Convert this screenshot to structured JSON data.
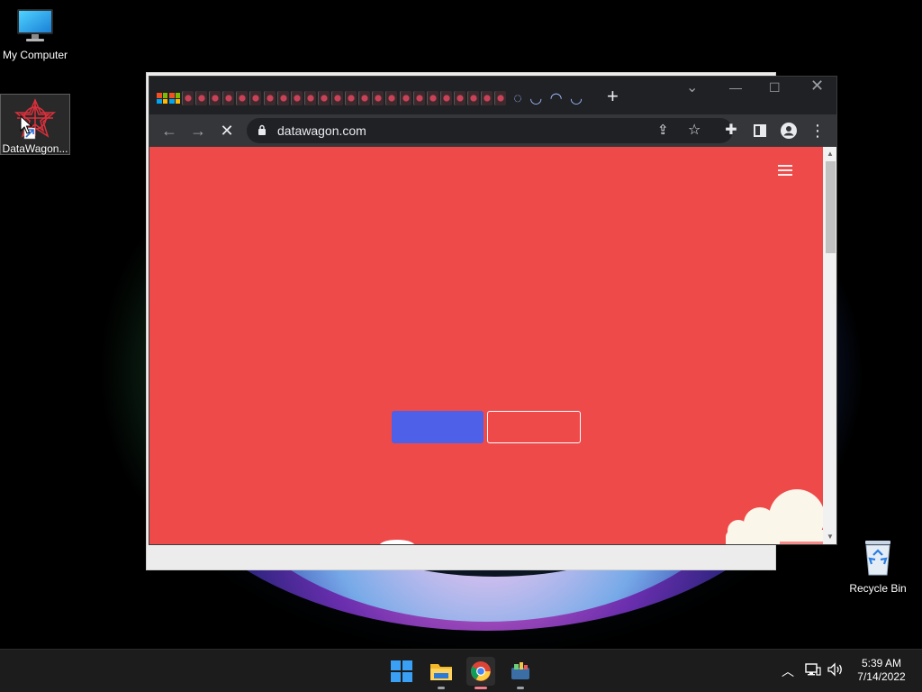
{
  "desktop": {
    "icons": [
      {
        "label": "My Computer",
        "icon": "monitor-icon"
      },
      {
        "label": "DataWagon...",
        "icon": "datawagon-app-icon"
      },
      {
        "label": "Recycle Bin",
        "icon": "recycle-bin-icon"
      }
    ]
  },
  "browser": {
    "url": "datawagon.com",
    "colors": {
      "page_background": "#ef4a4a",
      "primary_button": "#4e5fe8",
      "chrome_dark": "#202124",
      "toolbar": "#35363a"
    }
  },
  "taskbar": {
    "apps": [
      "windows-start-icon",
      "file-explorer-icon",
      "chrome-icon",
      "datawagon-icon"
    ],
    "tray_icons": [
      "chevron-up-icon",
      "network-icon",
      "volume-icon"
    ],
    "clock": {
      "time": "5:39 AM",
      "date": "7/14/2022"
    }
  }
}
